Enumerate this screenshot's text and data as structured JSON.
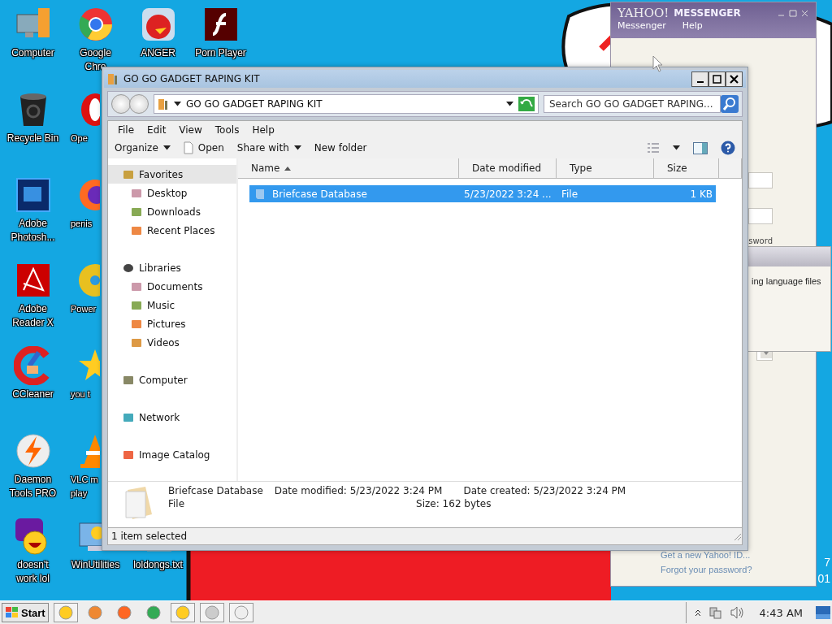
{
  "desktop": {
    "icons": [
      {
        "label": "Computer"
      },
      {
        "label": "Google\nChro"
      },
      {
        "label": "ANGER"
      },
      {
        "label": "Porn Player"
      },
      {
        "label": "Recycle Bin"
      },
      {
        "label": "Ope"
      },
      {
        "label": "Adobe\nPhotosh..."
      },
      {
        "label": "penis"
      },
      {
        "label": "Adobe\nReader X"
      },
      {
        "label": "Power"
      },
      {
        "label": "CCleaner"
      },
      {
        "label": "you t"
      },
      {
        "label": "Daemon\nTools PRO"
      },
      {
        "label": "VLC m\nplay"
      },
      {
        "label": "doesn't\nwork lol"
      },
      {
        "label": "WinUtilities"
      },
      {
        "label": "loldongs.txt"
      }
    ],
    "watermark": [
      "7",
      "01"
    ]
  },
  "yahoo_window": {
    "logo": "YAHOO!",
    "title": "MESSENGER",
    "menu": [
      "Messenger",
      "Help"
    ],
    "partial_label": "sword",
    "links": [
      "Get a new Yahoo! ID...",
      "Forgot your password?"
    ]
  },
  "yahoo_dialog": {
    "message": "ing language files"
  },
  "explorer": {
    "title": "GO GO GADGET RAPING KIT",
    "address": "GO GO GADGET RAPING KIT",
    "search_placeholder": "Search GO GO GADGET RAPING...",
    "menu": [
      "File",
      "Edit",
      "View",
      "Tools",
      "Help"
    ],
    "commands": [
      {
        "label": "Organize",
        "kind": "dropdown"
      },
      {
        "label": "Open",
        "kind": "document"
      },
      {
        "label": "Share with",
        "kind": "dropdown"
      },
      {
        "label": "New folder",
        "kind": "plain"
      }
    ],
    "nav": [
      {
        "label": "Favorites",
        "selected": true,
        "children": [
          {
            "label": "Desktop"
          },
          {
            "label": "Downloads"
          },
          {
            "label": "Recent Places"
          }
        ]
      },
      {
        "label": "Libraries",
        "selected": false,
        "children": [
          {
            "label": "Documents"
          },
          {
            "label": "Music"
          },
          {
            "label": "Pictures"
          },
          {
            "label": "Videos"
          }
        ]
      },
      {
        "label": "Computer",
        "selected": false
      },
      {
        "label": "Network",
        "selected": false
      },
      {
        "label": "Image Catalog",
        "selected": false
      }
    ],
    "columns": [
      {
        "label": "Name",
        "sorted": true
      },
      {
        "label": "Date modified",
        "sorted": false
      },
      {
        "label": "Type",
        "sorted": false
      },
      {
        "label": "Size",
        "sorted": false
      }
    ],
    "rows": [
      {
        "name": "Briefcase Database",
        "date": "5/23/2022 3:24 ...",
        "type": "File",
        "size": "1 KB",
        "selected": true
      }
    ],
    "details": {
      "name": "Briefcase Database",
      "type": "File",
      "fields": [
        {
          "label": "Date modified:",
          "value": "5/23/2022 3:24 PM"
        },
        {
          "label": "Date created:",
          "value": "5/23/2022 3:24 PM"
        },
        {
          "label": "Size:",
          "value": "162 bytes"
        }
      ]
    },
    "status": "1 item selected"
  },
  "taskbar": {
    "start": "Start",
    "buttons": [
      {
        "open": true
      },
      {
        "open": false
      },
      {
        "open": false
      },
      {
        "open": false
      },
      {
        "open": true
      },
      {
        "open": true
      },
      {
        "open": true
      }
    ],
    "clock": "4:43 AM"
  }
}
